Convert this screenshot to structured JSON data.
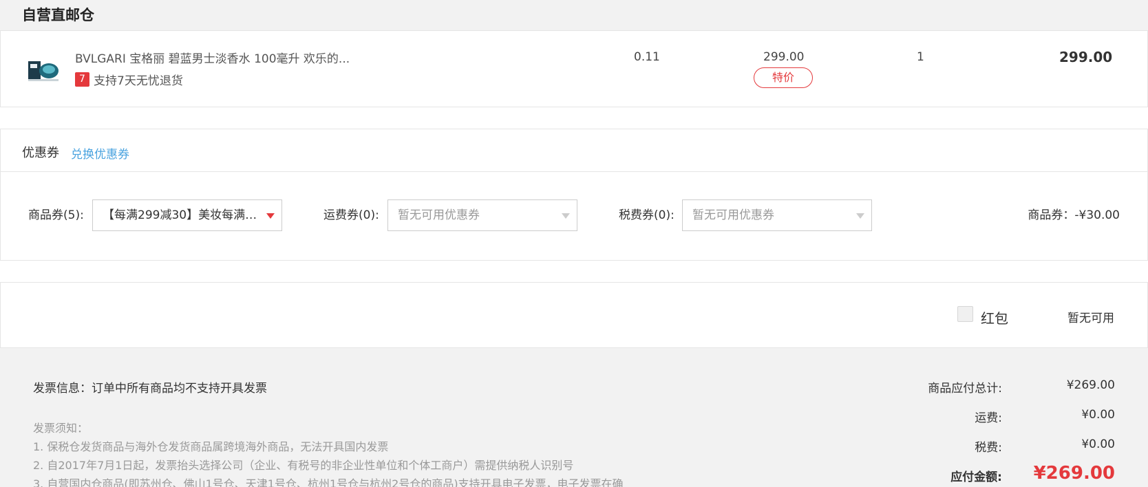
{
  "warehouse": {
    "title": "自营直邮仓"
  },
  "product": {
    "image_icon": "perfume-bottle-icon",
    "name": "BVLGARI 宝格丽 碧蓝男士淡香水 100毫升 欢乐的...",
    "return_badge_icon": "7",
    "return_policy": "支持7天无忧退货",
    "tax_rate": "0.11",
    "unit_price": "299.00",
    "special_tag": "特价",
    "quantity": "1",
    "subtotal": "299.00"
  },
  "coupons": {
    "title": "优惠券",
    "exchange_link": "兑换优惠券",
    "goods_coupon": {
      "label": "商品券(5):",
      "selected": "【每满299减30】美妆每满2..."
    },
    "shipping_coupon": {
      "label": "运费券(0):",
      "selected": "暂无可用优惠券"
    },
    "tax_coupon": {
      "label": "税费券(0):",
      "selected": "暂无可用优惠券"
    },
    "discount_summary": "商品券：-¥30.00"
  },
  "red_packet": {
    "label": "红包",
    "status": "暂无可用"
  },
  "invoice": {
    "info": "发票信息：订单中所有商品均不支持开具发票",
    "notice_title": "发票须知：",
    "notice_lines": [
      "1. 保税仓发货商品与海外仓发货商品属跨境海外商品，无法开具国内发票",
      "2. 自2017年7月1日起，发票抬头选择公司（企业、有税号的非企业性单位和个体工商户）需提供纳税人识别号",
      "3. 自营国内仓商品(即苏州仓、佛山1号仓、天津1号仓、杭州1号仓与杭州2号仓的商品)支持开具电子发票，电子发票在确"
    ]
  },
  "totals": {
    "goods_total_label": "商品应付总计:",
    "goods_total_value": "¥269.00",
    "shipping_label": "运费:",
    "shipping_value": "¥0.00",
    "tax_label": "税费:",
    "tax_value": "¥0.00",
    "payable_label": "应付金额:",
    "payable_value": "¥269.00"
  },
  "colors": {
    "accent_red": "#e4393c",
    "link_blue": "#4aa3df"
  }
}
